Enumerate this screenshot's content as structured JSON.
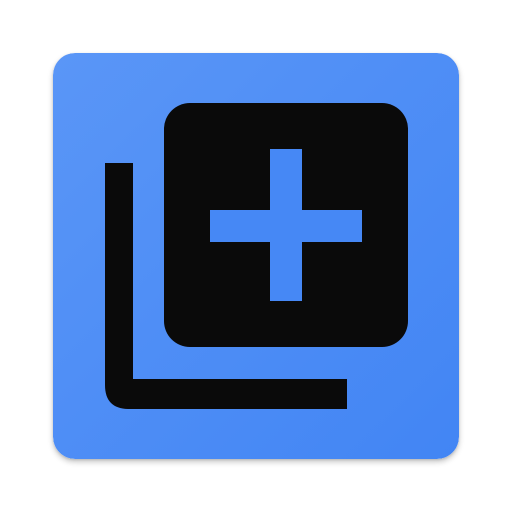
{
  "app_icon": {
    "icon_name": "add-to-library-icon",
    "glyph_name": "library-add-icon",
    "colors": {
      "background_start": "#5a96f7",
      "background_end": "#4285f4",
      "glyph": "#0a0a0a",
      "plus": "#4688f5"
    }
  }
}
